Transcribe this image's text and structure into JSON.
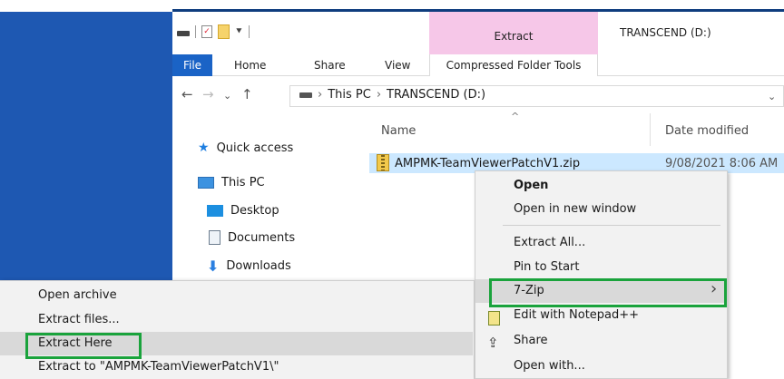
{
  "window": {
    "contextual_tab_title": "Extract",
    "title": "TRANSCEND (D:)"
  },
  "ribbon": {
    "tabs": [
      "File",
      "Home",
      "Share",
      "View",
      "Compressed Folder Tools"
    ]
  },
  "address": {
    "crumbs": [
      "This PC",
      "TRANSCEND (D:)"
    ]
  },
  "nav_pane": {
    "items": [
      "Quick access",
      "This PC",
      "Desktop",
      "Documents",
      "Downloads"
    ]
  },
  "file_list": {
    "columns": [
      "Name",
      "Date modified"
    ],
    "rows": [
      {
        "name": "AMPMK-TeamViewerPatchV1.zip",
        "date": "9/08/2021 8:06 AM"
      }
    ]
  },
  "context_menu": {
    "items": [
      "Open",
      "Open in new window",
      "Extract All...",
      "Pin to Start",
      "7-Zip",
      "Edit with Notepad++",
      "Share",
      "Open with..."
    ]
  },
  "sevenzip_submenu": {
    "items": [
      "Open archive",
      "Extract files...",
      "Extract Here",
      "Extract to \"AMPMK-TeamViewerPatchV1\\\""
    ]
  },
  "colors": {
    "desktop": "#1e58b2",
    "file_tab": "#1a63c6",
    "contextual_tab": "#f6c7e8",
    "selection": "#cce8ff",
    "highlight_box": "#1aa33c"
  },
  "icons": [
    "drive-icon",
    "checklist-icon",
    "folder-icon",
    "back-arrow-icon",
    "forward-arrow-icon",
    "up-arrow-icon",
    "star-icon",
    "pc-icon",
    "desktop-icon",
    "documents-icon",
    "downloads-icon",
    "zip-icon",
    "notepad-icon",
    "share-icon",
    "chevron-right-icon"
  ]
}
